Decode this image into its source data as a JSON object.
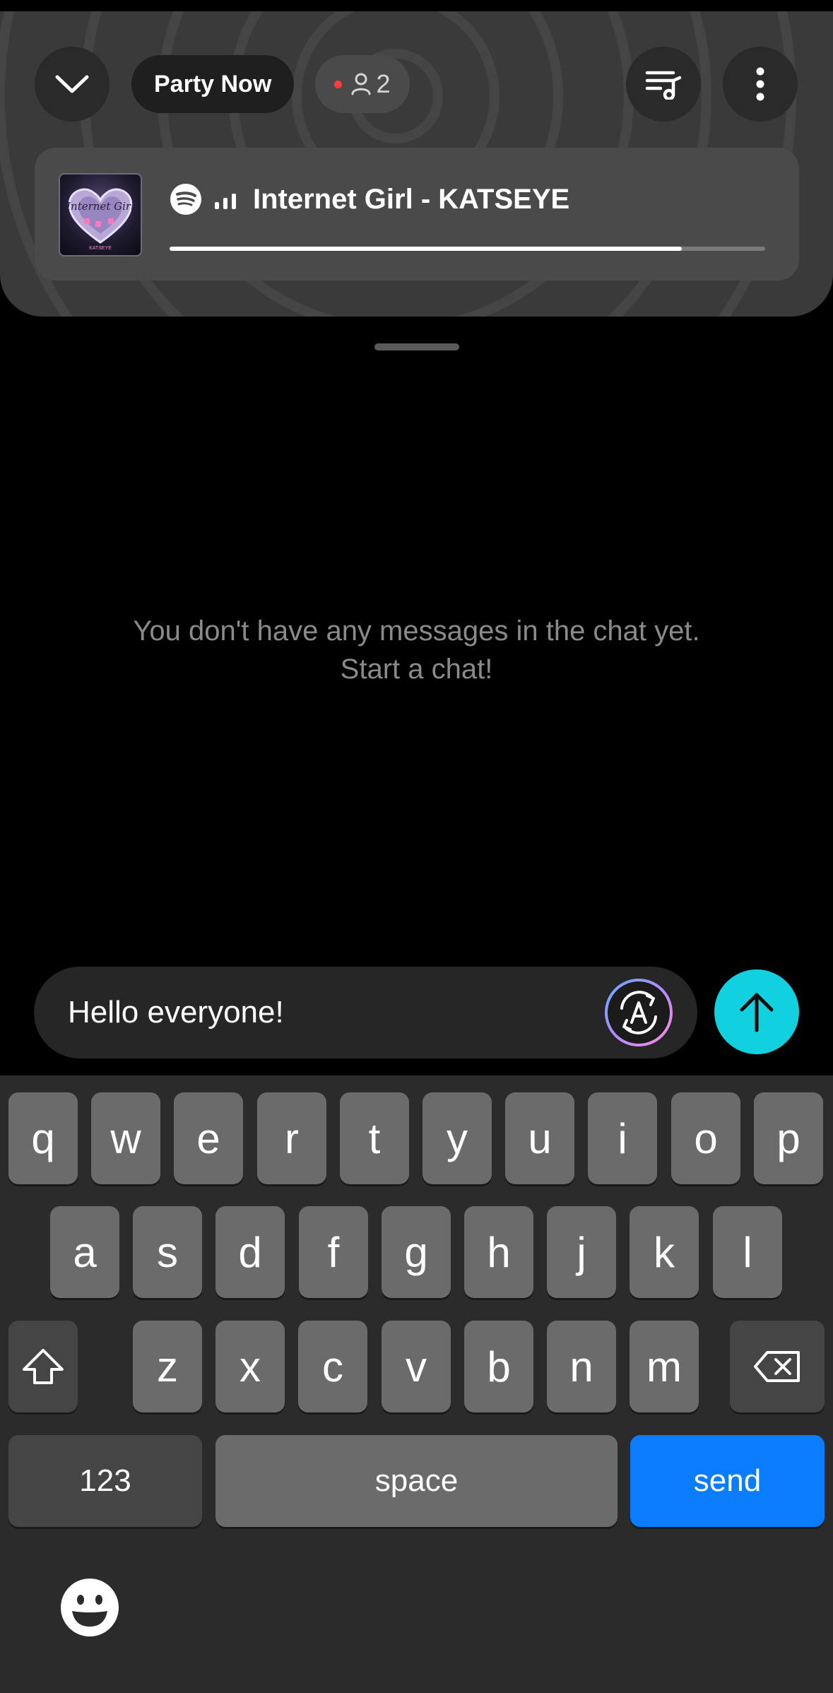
{
  "party": {
    "title": "Party Now",
    "member_count": "2"
  },
  "now_playing": {
    "track": "Internet Girl - KATSEYE",
    "progress_fraction": 0.86,
    "album_art_text": "Internet Girl",
    "album_art_artist": "KATSEYE"
  },
  "chat": {
    "empty_line1": "You don't have any messages in the chat yet.",
    "empty_line2": "Start a chat!"
  },
  "composer": {
    "value": "Hello everyone!"
  },
  "keyboard": {
    "row1": [
      "q",
      "w",
      "e",
      "r",
      "t",
      "y",
      "u",
      "i",
      "o",
      "p"
    ],
    "row2": [
      "a",
      "s",
      "d",
      "f",
      "g",
      "h",
      "j",
      "k",
      "l"
    ],
    "row3": [
      "z",
      "x",
      "c",
      "v",
      "b",
      "n",
      "m"
    ],
    "numbers_label": "123",
    "space_label": "space",
    "send_label": "send"
  },
  "colors": {
    "send_button": "#11d1e0",
    "keyboard_send": "#0a7cff",
    "live_dot": "#ff3b3b"
  }
}
